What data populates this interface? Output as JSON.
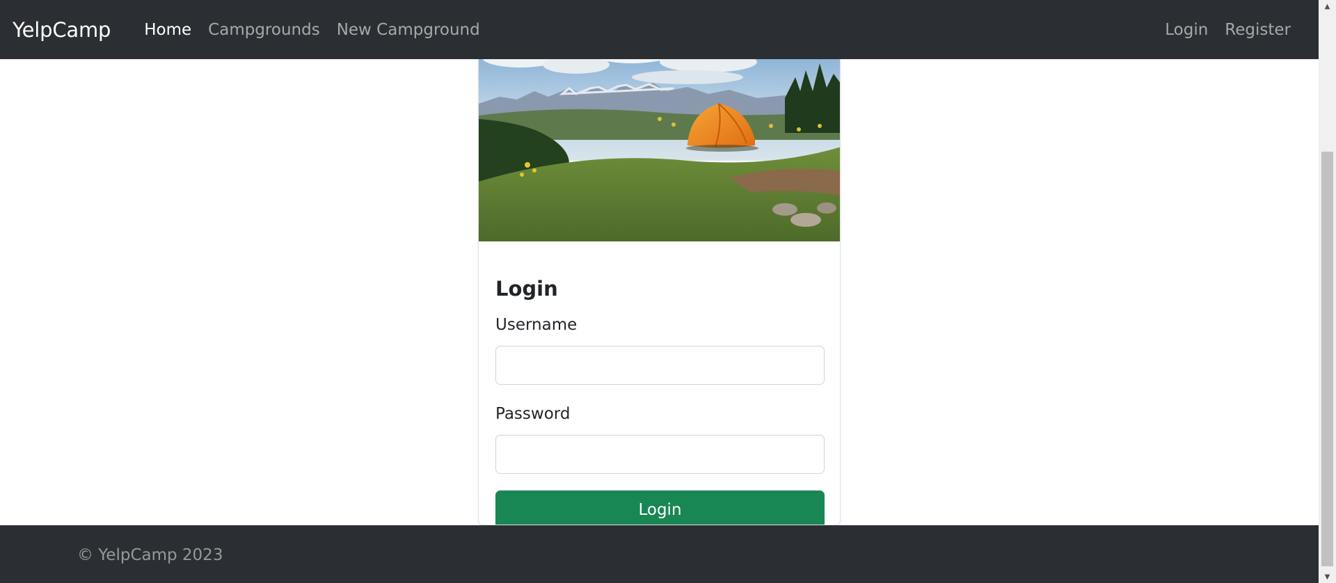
{
  "navbar": {
    "brand": "YelpCamp",
    "links": [
      {
        "label": "Home",
        "active": true
      },
      {
        "label": "Campgrounds",
        "active": false
      },
      {
        "label": "New Campground",
        "active": false
      }
    ],
    "right_links": [
      {
        "label": "Login"
      },
      {
        "label": "Register"
      }
    ]
  },
  "login_card": {
    "image_alt": "orange-tent-on-grassy-hill-with-mountains",
    "title": "Login",
    "username_label": "Username",
    "username_value": "",
    "password_label": "Password",
    "password_value": "",
    "submit_label": "Login"
  },
  "footer": {
    "text": "© YelpCamp 2023"
  },
  "colors": {
    "navbar_bg": "#2b2f33",
    "button_green": "#198754",
    "text_dark": "#212529"
  }
}
